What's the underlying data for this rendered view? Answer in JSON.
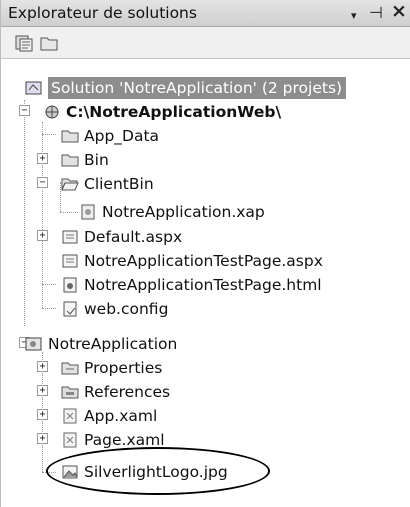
{
  "window": {
    "title": "Explorateur de solutions",
    "dropdown_glyph": "▾",
    "pin_glyph": "⊣",
    "close_glyph": "×"
  },
  "toolbar": {
    "buttons": [
      {
        "icon": "properties-icon"
      },
      {
        "icon": "show-all-files-icon"
      }
    ]
  },
  "tree": {
    "expand_glyph": "+",
    "collapse_glyph": "−",
    "items": [
      {
        "label": "Solution 'NotreApplication' (2 projets)",
        "icon": "solution-icon",
        "selected": true
      },
      {
        "label": "C:\\NotreApplicationWeb\\",
        "icon": "web-project-icon",
        "bold": true,
        "state": "expanded"
      },
      {
        "label": "App_Data",
        "icon": "folder-icon"
      },
      {
        "label": "Bin",
        "icon": "folder-icon",
        "state": "collapsed"
      },
      {
        "label": "ClientBin",
        "icon": "folder-open-icon",
        "state": "expanded"
      },
      {
        "label": "NotreApplication.xap",
        "icon": "xap-file-icon"
      },
      {
        "label": "Default.aspx",
        "icon": "aspx-file-icon",
        "state": "collapsed"
      },
      {
        "label": "NotreApplicationTestPage.aspx",
        "icon": "aspx-file-icon"
      },
      {
        "label": "NotreApplicationTestPage.html",
        "icon": "html-file-icon"
      },
      {
        "label": "web.config",
        "icon": "config-file-icon"
      },
      {
        "label": "NotreApplication",
        "icon": "silverlight-project-icon",
        "state": "expanded"
      },
      {
        "label": "Properties",
        "icon": "properties-folder-icon",
        "state": "collapsed"
      },
      {
        "label": "References",
        "icon": "references-icon",
        "state": "collapsed"
      },
      {
        "label": "App.xaml",
        "icon": "xaml-file-icon",
        "state": "collapsed"
      },
      {
        "label": "Page.xaml",
        "icon": "xaml-file-icon",
        "state": "collapsed"
      },
      {
        "label": "SilverlightLogo.jpg",
        "icon": "image-file-icon",
        "highlighted": true
      }
    ]
  }
}
